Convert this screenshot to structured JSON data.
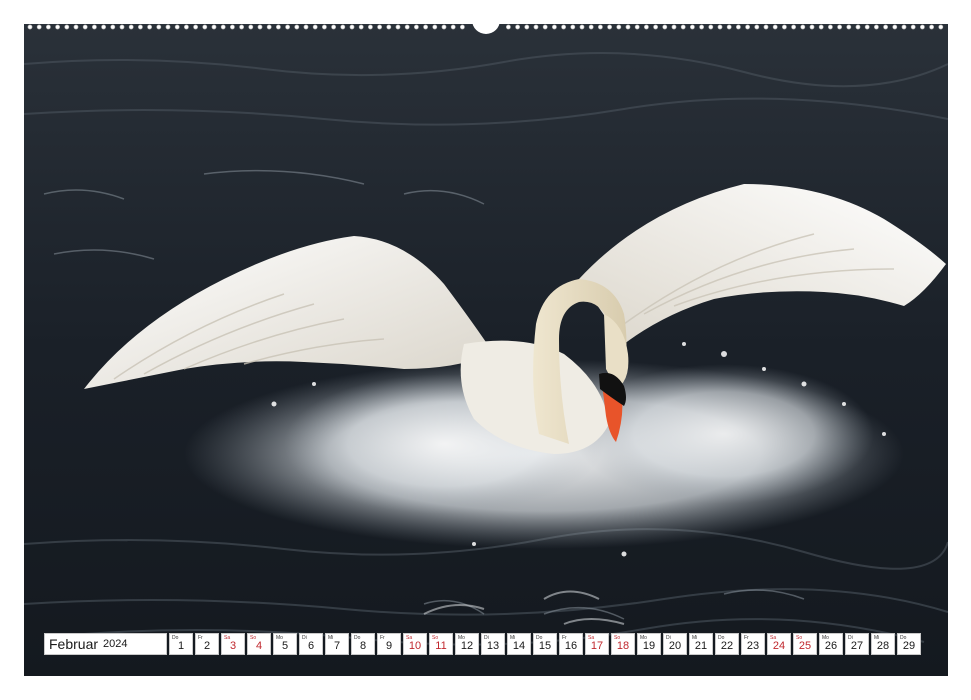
{
  "calendar": {
    "month": "Februar",
    "year": "2024",
    "accent_weekend": "#c0272d",
    "days": [
      {
        "wd": "Do",
        "n": "1",
        "we": false
      },
      {
        "wd": "Fr",
        "n": "2",
        "we": false
      },
      {
        "wd": "Sa",
        "n": "3",
        "we": true
      },
      {
        "wd": "So",
        "n": "4",
        "we": true
      },
      {
        "wd": "Mo",
        "n": "5",
        "we": false
      },
      {
        "wd": "Di",
        "n": "6",
        "we": false
      },
      {
        "wd": "Mi",
        "n": "7",
        "we": false
      },
      {
        "wd": "Do",
        "n": "8",
        "we": false
      },
      {
        "wd": "Fr",
        "n": "9",
        "we": false
      },
      {
        "wd": "Sa",
        "n": "10",
        "we": true
      },
      {
        "wd": "So",
        "n": "11",
        "we": true
      },
      {
        "wd": "Mo",
        "n": "12",
        "we": false
      },
      {
        "wd": "Di",
        "n": "13",
        "we": false
      },
      {
        "wd": "Mi",
        "n": "14",
        "we": false
      },
      {
        "wd": "Do",
        "n": "15",
        "we": false
      },
      {
        "wd": "Fr",
        "n": "16",
        "we": false
      },
      {
        "wd": "Sa",
        "n": "17",
        "we": true
      },
      {
        "wd": "So",
        "n": "18",
        "we": true
      },
      {
        "wd": "Mo",
        "n": "19",
        "we": false
      },
      {
        "wd": "Di",
        "n": "20",
        "we": false
      },
      {
        "wd": "Mi",
        "n": "21",
        "we": false
      },
      {
        "wd": "Do",
        "n": "22",
        "we": false
      },
      {
        "wd": "Fr",
        "n": "23",
        "we": false
      },
      {
        "wd": "Sa",
        "n": "24",
        "we": true
      },
      {
        "wd": "So",
        "n": "25",
        "we": true
      },
      {
        "wd": "Mo",
        "n": "26",
        "we": false
      },
      {
        "wd": "Di",
        "n": "27",
        "we": false
      },
      {
        "wd": "Mi",
        "n": "28",
        "we": false
      },
      {
        "wd": "Do",
        "n": "29",
        "we": false
      }
    ]
  },
  "photo": {
    "subject": "swan-icon",
    "water_color": "#1c232b",
    "feather_color": "#f4f1ea",
    "beak_color": "#e8542a"
  }
}
